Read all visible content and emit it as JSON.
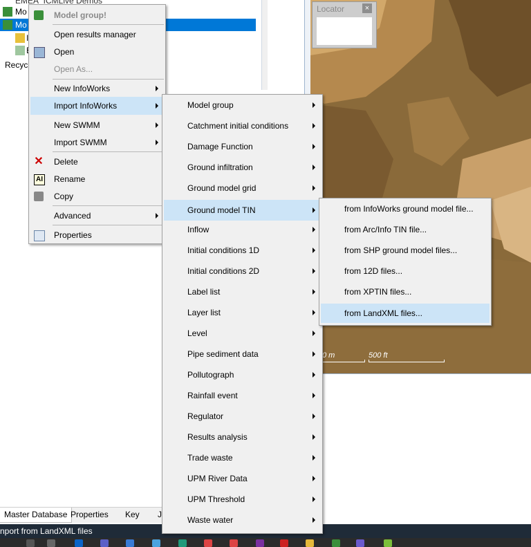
{
  "tree": {
    "items": [
      {
        "label": "EMEA_ICMLive Demos"
      },
      {
        "label": "Mo"
      },
      {
        "label": "Mo"
      },
      {
        "label": "I"
      },
      {
        "label": "E"
      },
      {
        "label": "Recycl"
      }
    ]
  },
  "locator": {
    "title": "Locator",
    "close": "×"
  },
  "scale": {
    "label1": "0 m",
    "label2": "500 ft"
  },
  "tabs": [
    {
      "label": "Master Database"
    },
    {
      "label": "Properties"
    },
    {
      "label": "Key"
    },
    {
      "label": "Je"
    }
  ],
  "status_text": "nport from LandXML files",
  "menu_main": {
    "header": "Model group!",
    "items": [
      {
        "label": "Open results manager"
      },
      {
        "label": "Open"
      },
      {
        "label": "Open As..."
      },
      {
        "label": "New InfoWorks"
      },
      {
        "label": "Import InfoWorks"
      },
      {
        "label": "New SWMM"
      },
      {
        "label": "Import SWMM"
      },
      {
        "label": "Delete"
      },
      {
        "label": "Rename"
      },
      {
        "label": "Copy"
      },
      {
        "label": "Advanced"
      },
      {
        "label": "Properties"
      }
    ]
  },
  "menu_import": {
    "items": [
      {
        "label": "Model group"
      },
      {
        "label": "Catchment initial conditions"
      },
      {
        "label": "Damage Function"
      },
      {
        "label": "Ground infiltration"
      },
      {
        "label": "Ground model grid"
      },
      {
        "label": "Ground model TIN"
      },
      {
        "label": "Inflow"
      },
      {
        "label": "Initial conditions 1D"
      },
      {
        "label": "Initial conditions 2D"
      },
      {
        "label": "Label list"
      },
      {
        "label": "Layer list"
      },
      {
        "label": "Level"
      },
      {
        "label": "Pipe sediment data"
      },
      {
        "label": "Pollutograph"
      },
      {
        "label": "Rainfall event"
      },
      {
        "label": "Regulator"
      },
      {
        "label": "Results analysis"
      },
      {
        "label": "Trade waste"
      },
      {
        "label": "UPM River Data"
      },
      {
        "label": "UPM Threshold"
      },
      {
        "label": "Waste water"
      }
    ]
  },
  "menu_tin": {
    "items": [
      {
        "label": "from InfoWorks ground model file..."
      },
      {
        "label": "from Arc/Info TIN file..."
      },
      {
        "label": "from SHP ground model files..."
      },
      {
        "label": "from 12D files..."
      },
      {
        "label": "from XPTIN files..."
      },
      {
        "label": "from LandXML files..."
      }
    ]
  },
  "colors": {
    "highlight": "#cce4f7",
    "selection": "#0078d7",
    "menu_bg": "#f0f0f0",
    "map_terrain": "#8a6a3a"
  },
  "icons": [
    "model-group-icon",
    "results-manager-icon",
    "delete-icon",
    "rename-icon",
    "copy-icon",
    "properties-icon",
    "submenu-arrow-icon"
  ]
}
